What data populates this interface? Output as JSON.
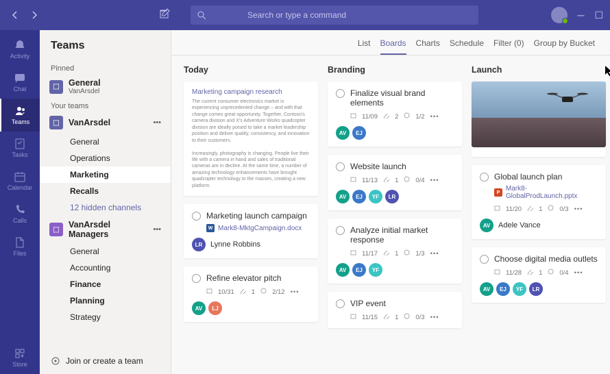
{
  "search": {
    "placeholder": "Search or type a command"
  },
  "rail": [
    {
      "id": "activity",
      "label": "Activity"
    },
    {
      "id": "chat",
      "label": "Chat"
    },
    {
      "id": "teams",
      "label": "Teams"
    },
    {
      "id": "tasks",
      "label": "Tasks"
    },
    {
      "id": "calendar",
      "label": "Calendar"
    },
    {
      "id": "calls",
      "label": "Calls"
    },
    {
      "id": "files",
      "label": "Files"
    },
    {
      "id": "store",
      "label": "Store"
    }
  ],
  "sidebar": {
    "title": "Teams",
    "pinned_label": "Pinned",
    "pinned": {
      "name": "General",
      "sub": "VanArsdel"
    },
    "your_teams_label": "Your teams",
    "teams": [
      {
        "name": "VanArsdel",
        "icon_color": "purple",
        "channels": [
          {
            "name": "General",
            "bold": false
          },
          {
            "name": "Operations",
            "bold": false
          },
          {
            "name": "Marketing",
            "bold": true,
            "selected": true
          },
          {
            "name": "Recalls",
            "bold": true
          },
          {
            "name": "12 hidden channels",
            "link": true
          }
        ]
      },
      {
        "name": "VanArsdel Managers",
        "icon_color": "violet",
        "channels": [
          {
            "name": "General",
            "bold": false
          },
          {
            "name": "Accounting",
            "bold": false
          },
          {
            "name": "Finance",
            "bold": true
          },
          {
            "name": "Planning",
            "bold": true
          },
          {
            "name": "Strategy",
            "bold": false
          }
        ]
      }
    ],
    "footer": "Join or create a team"
  },
  "tabs": [
    "List",
    "Boards",
    "Charts",
    "Schedule",
    "Filter (0)",
    "Group by Bucket"
  ],
  "selected_tab": 1,
  "board": {
    "columns": [
      {
        "title": "Today",
        "cards": [
          {
            "type": "doc",
            "doc_title": "Marketing campaign research",
            "body": "The current consumer electronics market is experiencing unprecedented change – and with that change comes great opportunity. Together, Contoso's camera division and X's Adventure Works quadcopter division are ideally poised to take a market leadership position and deliver quality, consistency, and innovation to their customers.\nIncreasingly, photography is changing. People live their life with a camera in hand and sales of traditional cameras are in decline. At the same time, a number of amazing technology enhancements have brought quadcopter technology to the masses, creating a new platform."
          },
          {
            "title": "Marketing launch campaign",
            "attachment": {
              "type": "w",
              "name": "Mark8-MktgCampaign.docx"
            },
            "assignee": {
              "initials": "LR",
              "color": "#4f52b2",
              "name": "Lynne Robbins"
            }
          },
          {
            "title": "Refine elevator pitch",
            "date": "10/31",
            "attach": "1",
            "check": "2/12",
            "people": [
              {
                "initials": "AV",
                "color": "#13a08a"
              },
              {
                "initials": "LJ",
                "color": "#e8765c"
              }
            ]
          }
        ]
      },
      {
        "title": "Branding",
        "cards": [
          {
            "title": "Finalize visual brand elements",
            "date": "11/09",
            "attach": "2",
            "check": "1/2",
            "people": [
              {
                "initials": "AV",
                "color": "#13a08a"
              },
              {
                "initials": "EJ",
                "color": "#3a79c8"
              }
            ]
          },
          {
            "title": "Website launch",
            "date": "11/13",
            "attach": "1",
            "check": "0/4",
            "people": [
              {
                "initials": "AV",
                "color": "#13a08a"
              },
              {
                "initials": "EJ",
                "color": "#3a79c8"
              },
              {
                "initials": "YF",
                "color": "#3cc4c4"
              },
              {
                "initials": "LR",
                "color": "#4f52b2"
              }
            ]
          },
          {
            "title": "Analyze initial market response",
            "date": "11/17",
            "attach": "1",
            "check": "1/3",
            "people": [
              {
                "initials": "AV",
                "color": "#13a08a"
              },
              {
                "initials": "EJ",
                "color": "#3a79c8"
              },
              {
                "initials": "YF",
                "color": "#3cc4c4"
              }
            ]
          },
          {
            "title": "VIP event",
            "date": "11/15",
            "attach": "1",
            "check": "0/3"
          }
        ]
      },
      {
        "title": "Launch",
        "cards": [
          {
            "type": "image"
          },
          {
            "title": "Global launch plan",
            "attachment": {
              "type": "p",
              "name": "Mark8-GlobalProdLaunch.pptx"
            },
            "date": "11/20",
            "attach": "1",
            "check": "0/3",
            "assignee": {
              "initials": "AV",
              "color": "#13a08a",
              "name": "Adele Vance"
            }
          },
          {
            "title": "Choose digital media outlets",
            "date": "11/28",
            "attach": "1",
            "check": "0/4",
            "people": [
              {
                "initials": "AV",
                "color": "#13a08a"
              },
              {
                "initials": "EJ",
                "color": "#3a79c8"
              },
              {
                "initials": "YF",
                "color": "#3cc4c4"
              },
              {
                "initials": "LR",
                "color": "#4f52b2"
              }
            ]
          }
        ]
      }
    ]
  }
}
